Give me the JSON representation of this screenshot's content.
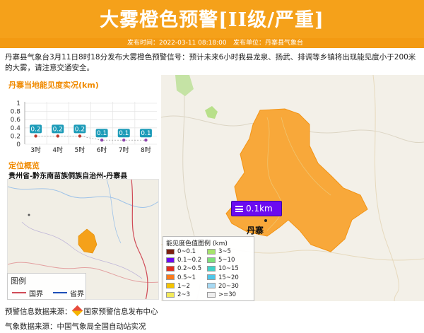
{
  "header": {
    "title": "大雾橙色预警[II级/严重]",
    "publish_time_label": "发布时间：2022-03-11 08:18:00",
    "publish_unit_label": "发布单位：丹寨县气象台",
    "color": "#f5a11a"
  },
  "notice": "丹寨县气象台3月11日8时18分发布大雾橙色预警信号：预计未来6小时我县龙泉、扬武、排调等乡镇将出现能见度小于200米的大雾，请注意交通安全。",
  "visibility_panel": {
    "title": "丹寨当地能见度实况(km)"
  },
  "chart_data": {
    "type": "line",
    "title": "丹寨当地能见度实况(km)",
    "categories": [
      "3时",
      "4时",
      "5时",
      "6时",
      "7时",
      "8时"
    ],
    "series": [
      {
        "values": [
          0.2,
          0.2,
          0.2,
          0.1,
          0.1,
          0.1
        ]
      }
    ],
    "data_labels": [
      "0.2",
      "0.2",
      "0.2",
      "0.1",
      "0.1",
      "0.1"
    ],
    "yticks": [
      "0",
      "0.2",
      "0.4",
      "0.6",
      "0.8",
      "1"
    ],
    "ylim": [
      0,
      1
    ],
    "point_colors": [
      "#c0392b",
      "#c0392b",
      "#c0392b",
      "#8e44ad",
      "#8e44ad",
      "#8e44ad"
    ],
    "label_color": "#1c9bb8",
    "grid": true
  },
  "location_panel": {
    "title": "定位概览",
    "region": "贵州省-黔东南苗族侗族自治州-丹寨县",
    "legend_title": "图例",
    "legend_national": "国界",
    "legend_province": "省界"
  },
  "main_map": {
    "badge": "0.1km",
    "city": "丹寨"
  },
  "visibility_legend": {
    "title": "能见度色值图例 (km)",
    "items": [
      {
        "label": "0~0.1",
        "color": "#7b1f0f"
      },
      {
        "label": "3~5",
        "color": "#a6e36b"
      },
      {
        "label": "0.1~0.2",
        "color": "#6b0af0"
      },
      {
        "label": "5~10",
        "color": "#7ee07a"
      },
      {
        "label": "0.2~0.5",
        "color": "#e32d1e"
      },
      {
        "label": "10~15",
        "color": "#3fd2c8"
      },
      {
        "label": "0.5~1",
        "color": "#ff7a1a"
      },
      {
        "label": "15~20",
        "color": "#4ec6ea"
      },
      {
        "label": "1~2",
        "color": "#f5c400"
      },
      {
        "label": "20~30",
        "color": "#a7d9f3"
      },
      {
        "label": "2~3",
        "color": "#f3ea5a"
      },
      {
        "label": ">=30",
        "color": "#eeeeee"
      }
    ]
  },
  "footer": {
    "warning_source": "预警信息数据来源：",
    "warning_source_name": "国家预警信息发布中心",
    "weather_source": "气象数据来源：中国气象局全国自动站实况"
  }
}
